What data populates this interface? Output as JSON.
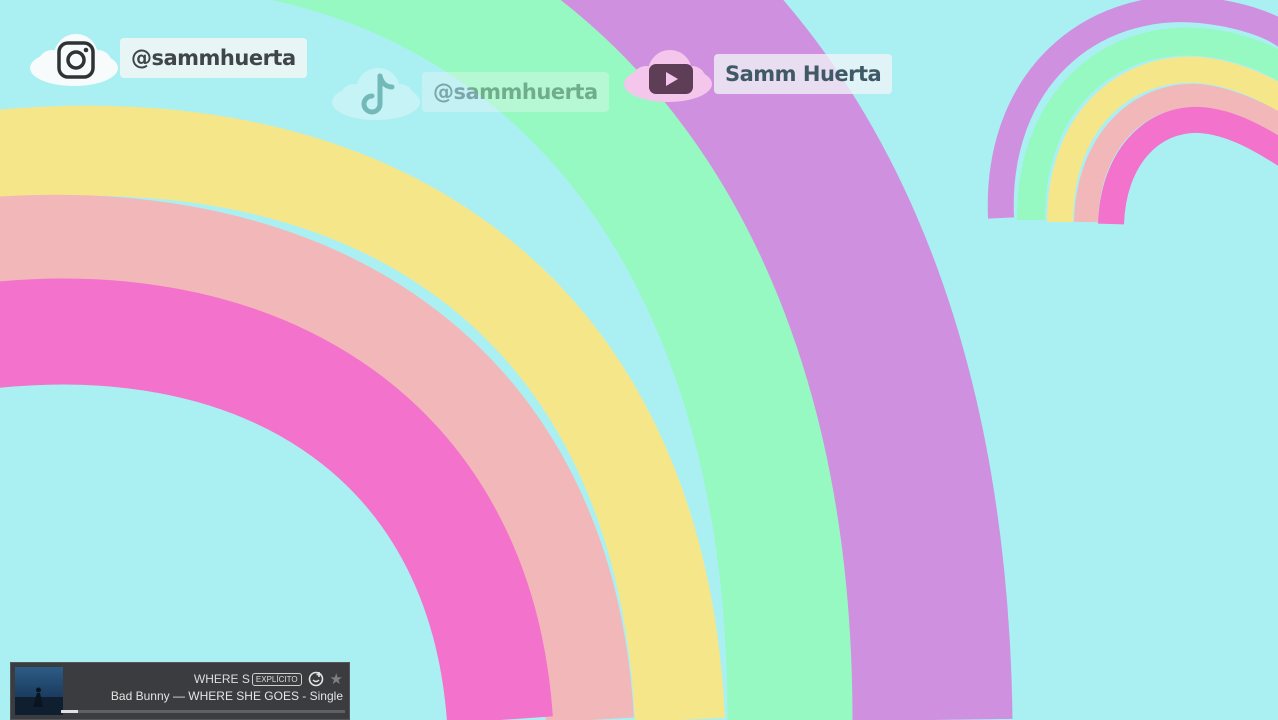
{
  "colors": {
    "background": "#aaf0f3",
    "rainbow_bands": [
      "#cf90df",
      "#95f9c1",
      "#f5e68a",
      "#f2b7b9",
      "#f372cb"
    ]
  },
  "socials": [
    {
      "platform": "instagram",
      "icon": "instagram-icon",
      "handle": "@sammhuerta"
    },
    {
      "platform": "tiktok",
      "icon": "tiktok-icon",
      "handle": "@sammhuerta"
    },
    {
      "platform": "youtube",
      "icon": "youtube-icon",
      "handle": "Samm Huerta"
    }
  ],
  "now_playing": {
    "title": "WHERE S",
    "explicit_label": "EXPLÍCITO",
    "subtitle": "Bad Bunny — WHERE SHE GOES - Single",
    "progress": 0.06,
    "icons": [
      "album-art",
      "add-icon",
      "star-icon"
    ]
  }
}
